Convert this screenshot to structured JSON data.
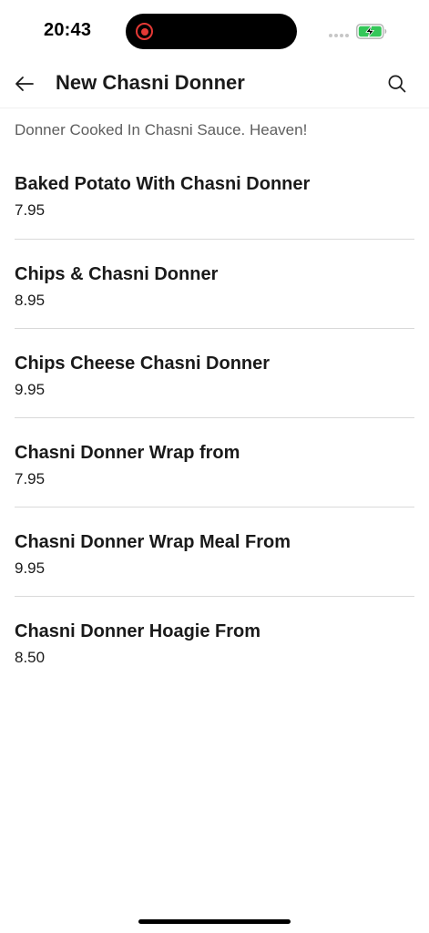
{
  "status_bar": {
    "time": "20:43",
    "battery_icon": "battery-charging-icon",
    "recording_icon": "screen-recording-icon"
  },
  "header": {
    "title": "New Chasni Donner",
    "back_icon": "arrow-left-icon",
    "search_icon": "search-icon"
  },
  "category": {
    "description": "Donner Cooked In Chasni Sauce. Heaven!"
  },
  "items": [
    {
      "name": "Baked Potato With Chasni Donner",
      "price": "7.95"
    },
    {
      "name": "Chips & Chasni Donner",
      "price": "8.95"
    },
    {
      "name": "Chips Cheese Chasni Donner",
      "price": "9.95"
    },
    {
      "name": "Chasni Donner Wrap from",
      "price": "7.95"
    },
    {
      "name": "Chasni Donner Wrap Meal From",
      "price": "9.95"
    },
    {
      "name": "Chasni Donner Hoagie From",
      "price": "8.50"
    }
  ],
  "colors": {
    "recording": "#e53935",
    "battery_fill": "#34c759",
    "divider": "#d9d9d9",
    "description_text": "#5f5f5f"
  }
}
